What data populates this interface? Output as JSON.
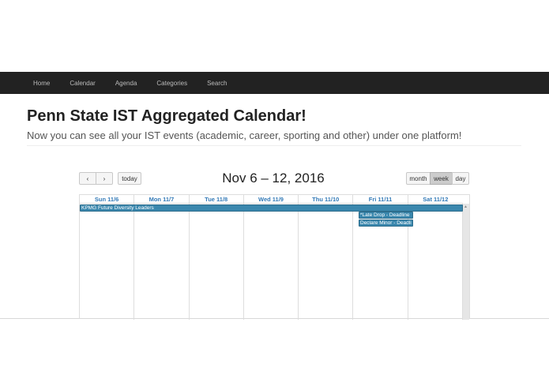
{
  "nav": {
    "items": [
      {
        "label": "Home"
      },
      {
        "label": "Calendar"
      },
      {
        "label": "Agenda"
      },
      {
        "label": "Categories"
      },
      {
        "label": "Search"
      }
    ]
  },
  "header": {
    "title": "Penn State IST Aggregated Calendar!",
    "subtitle": "Now you can see all your IST events (academic, career, sporting and other) under one platform!"
  },
  "calendar": {
    "title": "Nov 6 – 12, 2016",
    "prev_icon": "‹",
    "next_icon": "›",
    "today_label": "today",
    "views": {
      "month": "month",
      "week": "week",
      "day": "day"
    },
    "active_view": "week",
    "days": [
      "Sun 11/6",
      "Mon 11/7",
      "Tue 11/8",
      "Wed 11/9",
      "Thu 11/10",
      "Fri 11/11",
      "Sat 11/12"
    ],
    "events": [
      {
        "title": "KPMG Future Diversity Leaders"
      },
      {
        "title": "*Late Drop - Deadline"
      },
      {
        "title": "Declare Minor - Deadli"
      }
    ],
    "colors": {
      "event": "#3a87ad",
      "day_header": "#337ab7",
      "navbar": "#222222"
    }
  }
}
